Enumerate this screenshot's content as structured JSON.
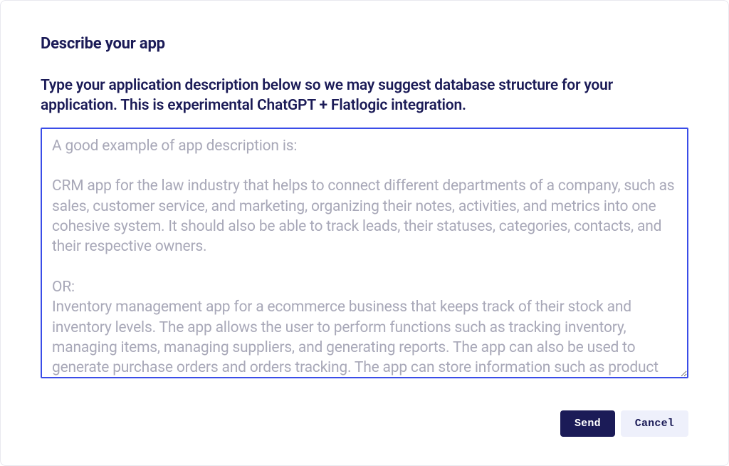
{
  "modal": {
    "title": "Describe your app",
    "instruction": "Type your application description below so we may suggest database structure for your application. This is experimental ChatGPT + Flatlogic integration.",
    "textarea": {
      "value": "",
      "placeholder": "A good example of app description is:\n\nCRM app for the law industry that helps to connect different departments of a company, such as sales, customer service, and marketing, organizing their notes, activities, and metrics into one cohesive system. It should also be able to track leads, their statuses, categories, contacts, and their respective owners.\n\nOR:\nInventory management app for a ecommerce business that keeps track of their stock and inventory levels. The app allows the user to perform functions such as tracking inventory, managing items, managing suppliers, and generating reports. The app can also be used to generate purchase orders and orders tracking. The app can store information such as product names, descriptions, images, and prices, and it can be used to create product"
    },
    "buttons": {
      "send_label": "Send",
      "cancel_label": "Cancel"
    }
  },
  "colors": {
    "brand_dark": "#1b1b57",
    "accent_blue": "#3a4de8",
    "placeholder_gray": "#a8a8b8",
    "secondary_bg": "#eef0fb"
  }
}
